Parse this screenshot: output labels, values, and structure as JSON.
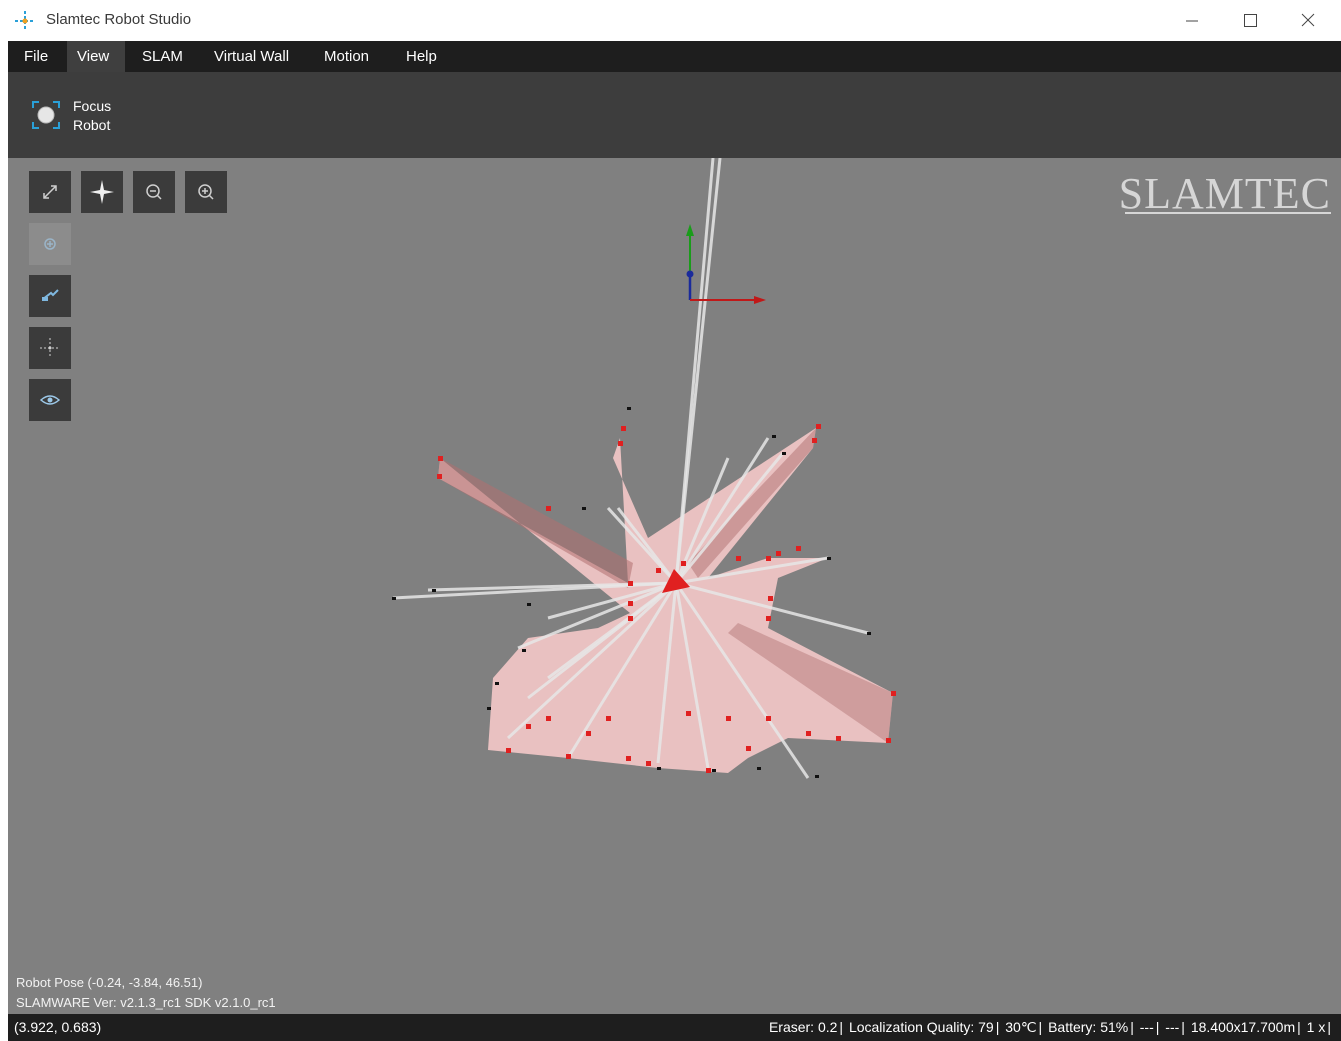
{
  "window": {
    "title": "Slamtec Robot Studio"
  },
  "menu": [
    {
      "label": "File"
    },
    {
      "label": "View"
    },
    {
      "label": "SLAM"
    },
    {
      "label": "Virtual Wall"
    },
    {
      "label": "Motion"
    },
    {
      "label": "Help"
    }
  ],
  "ribbon": {
    "focus_label_1": "Focus",
    "focus_label_2": "Robot"
  },
  "brand": "SLAMTEC",
  "info": {
    "robot_pose": "Robot Pose (-0.24, -3.84, 46.51)",
    "version": "SLAMWARE Ver: v2.1.3_rc1   SDK   v2.1.0_rc1"
  },
  "status": {
    "coord": "(3.922, 0.683)",
    "eraser": "Eraser: 0.2",
    "localization": "Localization Quality: 79",
    "temperature": "30℃",
    "battery": "Battery: 51%",
    "field1": "---",
    "field2": "---",
    "map_size": "18.400x17.700m",
    "zoom": "1 x"
  },
  "colors": {
    "menubar": "#1e1e1e",
    "ribbon": "#3d3d3d",
    "canvas": "#808080",
    "laser": "#e02020"
  }
}
